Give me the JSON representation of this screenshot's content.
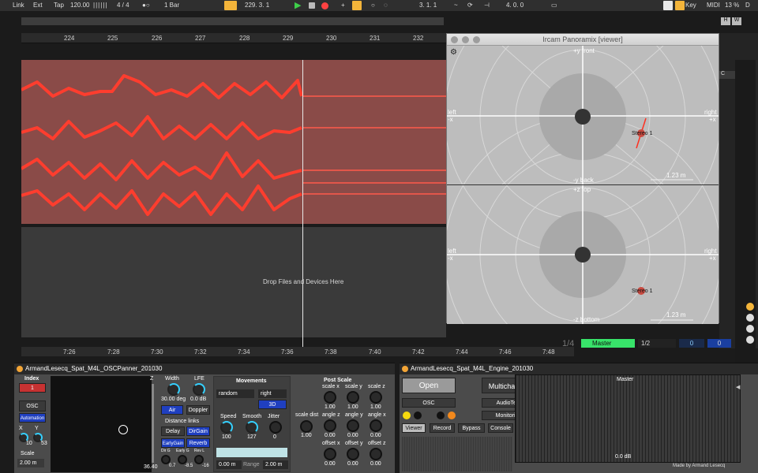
{
  "transport": {
    "link": "Link",
    "ext": "Ext",
    "tap": "Tap",
    "tempo": "120.00",
    "sig": "4 / 4",
    "quant": "1 Bar",
    "pos": "229.  3.  1",
    "loop_start": "3.  1.  1",
    "loop_len": "4.  0.  0",
    "key": "Key",
    "midi": "MIDI",
    "cpu": "13 %",
    "d": "D"
  },
  "ruler": [
    "224",
    "225",
    "226",
    "227",
    "228",
    "229",
    "230",
    "231",
    "232"
  ],
  "drop_text": "Drop Files and Devices Here",
  "timeline": [
    "7:26",
    "7:28",
    "7:30",
    "7:32",
    "7:34",
    "7:36",
    "7:38",
    "7:40",
    "7:42",
    "7:44",
    "7:46",
    "7:48"
  ],
  "panoramix": {
    "title": "Ircam Panoramix [viewer]",
    "front": "+y front",
    "back": "-y back",
    "top": "+z top",
    "bottom": "-z bottom",
    "left": "left",
    "minus_x": "-x",
    "right": "right",
    "plus_x": "+x",
    "source": "Stereo 1",
    "scale": "1.23 m"
  },
  "master_strip": {
    "name": "Master",
    "routing": "1/2",
    "v1": "0",
    "v2": "0"
  },
  "right_panel": {
    "hw": "H",
    "w": "W",
    "c": "C",
    "page": "1/4"
  },
  "osc_panner": {
    "title": "ArmandLesecq_Spat_M4L_OSCPanner_201030",
    "index": "Index",
    "index_val": "1",
    "osc": "OSC",
    "automation": "Automation",
    "x": "X",
    "y": "Y",
    "x_val": "10",
    "y_val": "53",
    "scale": "Scale",
    "scale_val": "2.00 m",
    "z": "Z",
    "z_val": "36.40",
    "width": "Width",
    "width_val": "30.00 deg",
    "lfe": "LFE",
    "lfe_val": "0.0 dB",
    "air": "Air",
    "doppler": "Doppler",
    "distance_links": "Distance links",
    "delay": "Delay",
    "dirgain": "DirGain",
    "earlygain": "EarlyGain",
    "reverb": "Reverb",
    "dirg": "Dir G",
    "earlyg": "Early G",
    "revl": "Rev L",
    "dirg_val": "0.7",
    "earlyg_val": "-8.5",
    "revl_val": "-16",
    "movements": "Movements",
    "mode": "random",
    "side": "right",
    "btn3d": "3D",
    "speed": "Speed",
    "smooth": "Smooth",
    "jitter": "Jitter",
    "speed_val": "100",
    "smooth_val": "127",
    "jitter_val": "0",
    "range_min": "0.00 m",
    "range": "Range",
    "range_max": "2.00 m",
    "post_scale": "Post Scale",
    "scale_dist": "scale dist",
    "scale_dist_val": "1.00",
    "scale_x": "scale x",
    "scale_y": "scale y",
    "scale_z": "scale z",
    "angle_z": "angle z",
    "angle_y": "angle y",
    "angle_x": "angle x",
    "offset_x": "offset x",
    "offset_y": "offset y",
    "offset_z": "offset z",
    "one": "1.00",
    "zero": "0.00"
  },
  "engine": {
    "title": "ArmandLesecq_Spat_M4L_Engine_201030",
    "open": "Open",
    "multichannel": "Multichannel",
    "osc": "OSC",
    "audiotest": "AudioTest",
    "monitoring": "Monitoring",
    "viewer": "Viewer",
    "record": "Record",
    "bypass": "Bypass",
    "console": "Console",
    "master": "Master",
    "db": "0.0 dB",
    "credit": "Made by Armand Lesecq"
  }
}
